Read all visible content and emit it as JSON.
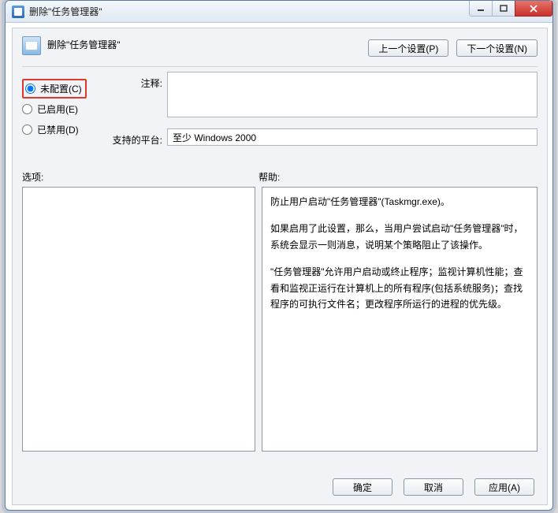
{
  "window": {
    "title": "删除\"任务管理器\""
  },
  "header": {
    "text": "删除\"任务管理器\""
  },
  "nav": {
    "prev": "上一个设置(P)",
    "next": "下一个设置(N)"
  },
  "radios": {
    "not_configured": "未配置(C)",
    "enabled": "已启用(E)",
    "disabled": "已禁用(D)",
    "selected": "not_configured"
  },
  "labels": {
    "note": "注释:",
    "supported_on": "支持的平台:",
    "options": "选项:",
    "help": "帮助:"
  },
  "supported_on_value": "至少 Windows 2000",
  "help": {
    "p1": "防止用户启动\"任务管理器\"(Taskmgr.exe)。",
    "p2": "如果启用了此设置，那么，当用户尝试启动\"任务管理器\"时，系统会显示一则消息，说明某个策略阻止了该操作。",
    "p3": "\"任务管理器\"允许用户启动或终止程序；监视计算机性能；查看和监视正运行在计算机上的所有程序(包括系统服务)；查找程序的可执行文件名；更改程序所运行的进程的优先级。"
  },
  "footer": {
    "ok": "确定",
    "cancel": "取消",
    "apply": "应用(A)"
  }
}
